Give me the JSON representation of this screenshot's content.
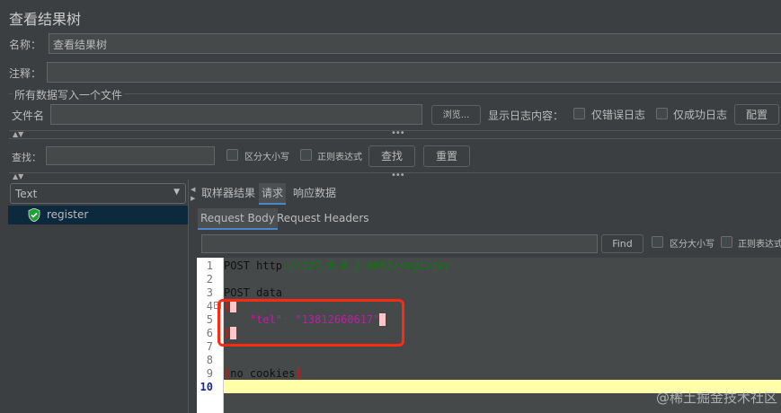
{
  "title": "查看结果树",
  "name_label": "名称：",
  "name_value": "查看结果树",
  "comment_label": "注释：",
  "file_group": "所有数据写入一个文件",
  "filename_label": "文件名",
  "browse": "浏览...",
  "log_label": "显示日志内容：",
  "errors_only": "仅错误日志",
  "success_only": "仅成功日志",
  "config": "配置",
  "search_label": "查找：",
  "case_sensitive": "区分大小写",
  "regex": "正则表达式",
  "find_btn": "查找",
  "reset_btn": "重置",
  "renderer": "Text",
  "tree": [
    {
      "label": "register",
      "status": "success"
    }
  ],
  "tabs": [
    "取样器结果",
    "请求",
    "响应数据"
  ],
  "active_tab": "请求",
  "subtabs": [
    "Request Body",
    "Request Headers"
  ],
  "find": "Find",
  "editor": {
    "line_numbers": [
      "1",
      "2",
      "3",
      "4",
      "5",
      "6",
      "7",
      "8",
      "9",
      "10"
    ],
    "l1a": "POST http",
    "l1b": "://127.0.0.1:8081/register",
    "l3a": "POST data",
    "l3b": ":",
    "l4": "{",
    "l5a": "\"tel\"",
    "l5b": ": ",
    "l5c": "\"13812660617\"",
    "l6": "}",
    "l9a": "[",
    "l9b": "no cookies",
    "l9c": "]"
  },
  "watermark": "@稀土掘金技术社区"
}
